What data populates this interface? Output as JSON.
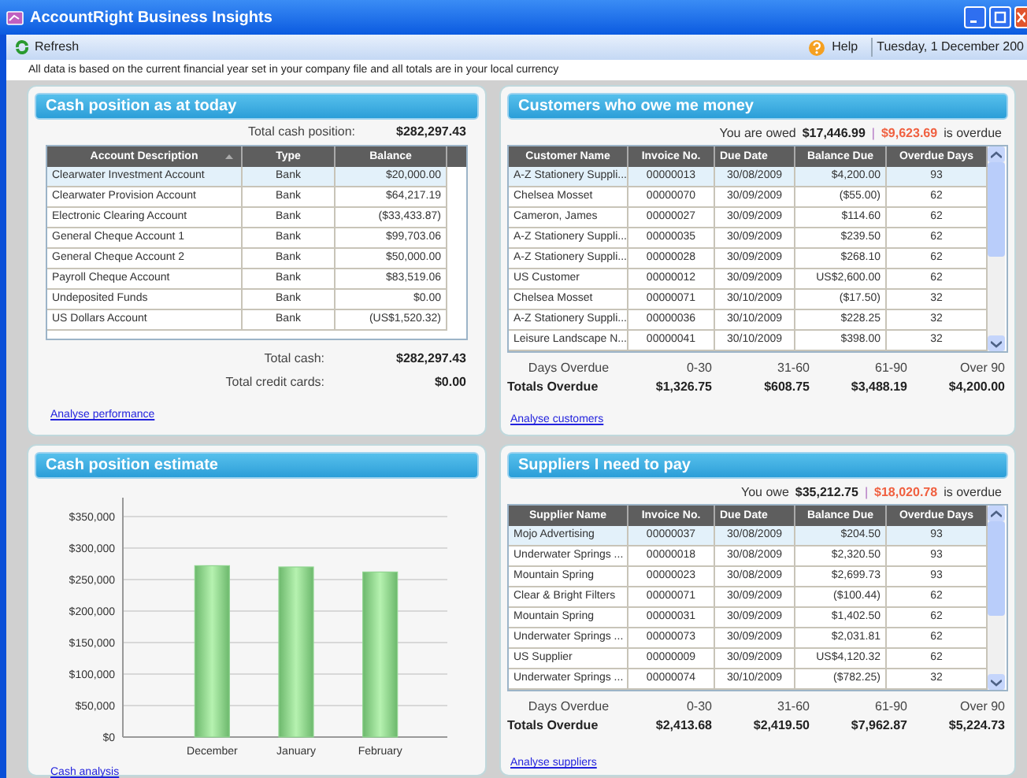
{
  "window": {
    "title": "AccountRight Business Insights"
  },
  "toolbar": {
    "refresh": "Refresh",
    "help": "Help",
    "date": "Tuesday, 1 December 200"
  },
  "notice": "All data is based on the current financial year set in your company file and all totals are in your local currency",
  "cash_position": {
    "title": "Cash position as at today",
    "total_label": "Total cash position:",
    "total_value": "$282,297.43",
    "table": {
      "columns": [
        {
          "label": "Account Description",
          "sorted": true
        },
        {
          "label": "Type",
          "sorted": false
        },
        {
          "label": "Balance",
          "sorted": false
        }
      ],
      "rows": [
        {
          "cells": [
            "Clearwater Investment Account",
            "Bank",
            "$20,000.00"
          ],
          "selected": true
        },
        {
          "cells": [
            "Clearwater Provision Account",
            "Bank",
            "$64,217.19"
          ],
          "selected": false
        },
        {
          "cells": [
            "Electronic Clearing Account",
            "Bank",
            "($33,433.87)"
          ],
          "selected": false
        },
        {
          "cells": [
            "General Cheque Account 1",
            "Bank",
            "$99,703.06"
          ],
          "selected": false
        },
        {
          "cells": [
            "General Cheque Account 2",
            "Bank",
            "$50,000.00"
          ],
          "selected": false
        },
        {
          "cells": [
            "Payroll Cheque Account",
            "Bank",
            "$83,519.06"
          ],
          "selected": false
        },
        {
          "cells": [
            "Undeposited Funds",
            "Bank",
            "$0.00"
          ],
          "selected": false
        },
        {
          "cells": [
            "US Dollars Account",
            "Bank",
            "(US$1,520.32)"
          ],
          "selected": false
        }
      ]
    },
    "totals": [
      {
        "label": "Total cash:",
        "value": "$282,297.43"
      },
      {
        "label": "Total credit cards:",
        "value": "$0.00"
      }
    ],
    "link": "Analyse performance"
  },
  "customers": {
    "title": "Customers who owe me money",
    "summary": {
      "label": "You are owed",
      "amount": "$17,446.99",
      "separator": "|",
      "overdue": "$9,623.69",
      "suffix": "is overdue"
    },
    "table": {
      "columns": [
        "Customer Name",
        "Invoice No.",
        "Due Date",
        "Balance Due",
        "Overdue Days"
      ],
      "rows": [
        {
          "cells": [
            "A-Z Stationery Suppli...",
            "00000013",
            "30/08/2009",
            "$4,200.00",
            "93"
          ],
          "selected": true
        },
        {
          "cells": [
            "Chelsea Mosset",
            "00000070",
            "30/09/2009",
            "($55.00)",
            "62"
          ],
          "selected": false
        },
        {
          "cells": [
            "Cameron, James",
            "00000027",
            "30/09/2009",
            "$114.60",
            "62"
          ],
          "selected": false
        },
        {
          "cells": [
            "A-Z Stationery Suppli...",
            "00000035",
            "30/09/2009",
            "$239.50",
            "62"
          ],
          "selected": false
        },
        {
          "cells": [
            "A-Z Stationery Suppli...",
            "00000028",
            "30/09/2009",
            "$268.10",
            "62"
          ],
          "selected": false
        },
        {
          "cells": [
            "US Customer",
            "00000012",
            "30/09/2009",
            "US$2,600.00",
            "62"
          ],
          "selected": false
        },
        {
          "cells": [
            "Chelsea Mosset",
            "00000071",
            "30/10/2009",
            "($17.50)",
            "32"
          ],
          "selected": false
        },
        {
          "cells": [
            "A-Z Stationery Suppli...",
            "00000036",
            "30/10/2009",
            "$228.25",
            "32"
          ],
          "selected": false
        },
        {
          "cells": [
            "Leisure Landscape N...",
            "00000041",
            "30/10/2009",
            "$398.00",
            "32"
          ],
          "selected": false
        }
      ]
    },
    "aging": {
      "headers": [
        "Days Overdue",
        "0-30",
        "31-60",
        "61-90",
        "Over 90"
      ],
      "totals": [
        "Totals Overdue",
        "$1,326.75",
        "$608.75",
        "$3,488.19",
        "$4,200.00"
      ]
    },
    "link": "Analyse customers"
  },
  "estimate": {
    "title": "Cash position estimate",
    "chart_data": {
      "type": "bar",
      "categories": [
        "December",
        "January",
        "February"
      ],
      "grid": true,
      "series": [
        {
          "color": "#8fd48f",
          "values": [
            272000,
            270000,
            262000
          ]
        }
      ],
      "ylim": [
        0,
        375000
      ],
      "yticks": [
        {
          "value": 0,
          "label": "$0"
        },
        {
          "value": 50000,
          "label": "$50,000"
        },
        {
          "value": 100000,
          "label": "$100,000"
        },
        {
          "value": 150000,
          "label": "$150,000"
        },
        {
          "value": 200000,
          "label": "$200,000"
        },
        {
          "value": 250000,
          "label": "$250,000"
        },
        {
          "value": 300000,
          "label": "$300,000"
        },
        {
          "value": 350000,
          "label": "$350,000"
        }
      ]
    },
    "link": "Cash analysis"
  },
  "suppliers": {
    "title": "Suppliers I need to pay",
    "summary": {
      "label": "You owe",
      "amount": "$35,212.75",
      "separator": "|",
      "overdue": "$18,020.78",
      "suffix": "is overdue"
    },
    "table": {
      "columns": [
        "Supplier Name",
        "Invoice No.",
        "Due Date",
        "Balance Due",
        "Overdue Days"
      ],
      "rows": [
        {
          "cells": [
            "Mojo Advertising",
            "00000037",
            "30/08/2009",
            "$204.50",
            "93"
          ],
          "selected": true
        },
        {
          "cells": [
            "Underwater Springs ...",
            "00000018",
            "30/08/2009",
            "$2,320.50",
            "93"
          ],
          "selected": false
        },
        {
          "cells": [
            "Mountain Spring",
            "00000023",
            "30/08/2009",
            "$2,699.73",
            "93"
          ],
          "selected": false
        },
        {
          "cells": [
            "Clear & Bright Filters",
            "00000071",
            "30/09/2009",
            "($100.44)",
            "62"
          ],
          "selected": false
        },
        {
          "cells": [
            "Mountain Spring",
            "00000031",
            "30/09/2009",
            "$1,402.50",
            "62"
          ],
          "selected": false
        },
        {
          "cells": [
            "Underwater Springs ...",
            "00000073",
            "30/09/2009",
            "$2,031.81",
            "62"
          ],
          "selected": false
        },
        {
          "cells": [
            "US Supplier",
            "00000009",
            "30/09/2009",
            "US$4,120.32",
            "62"
          ],
          "selected": false
        },
        {
          "cells": [
            "Underwater Springs ...",
            "00000074",
            "30/10/2009",
            "($782.25)",
            "32"
          ],
          "selected": false
        }
      ]
    },
    "aging": {
      "headers": [
        "Days Overdue",
        "0-30",
        "31-60",
        "61-90",
        "Over 90"
      ],
      "totals": [
        "Totals Overdue",
        "$2,413.68",
        "$2,419.50",
        "$7,962.87",
        "$5,224.73"
      ]
    },
    "link": "Analyse suppliers"
  }
}
